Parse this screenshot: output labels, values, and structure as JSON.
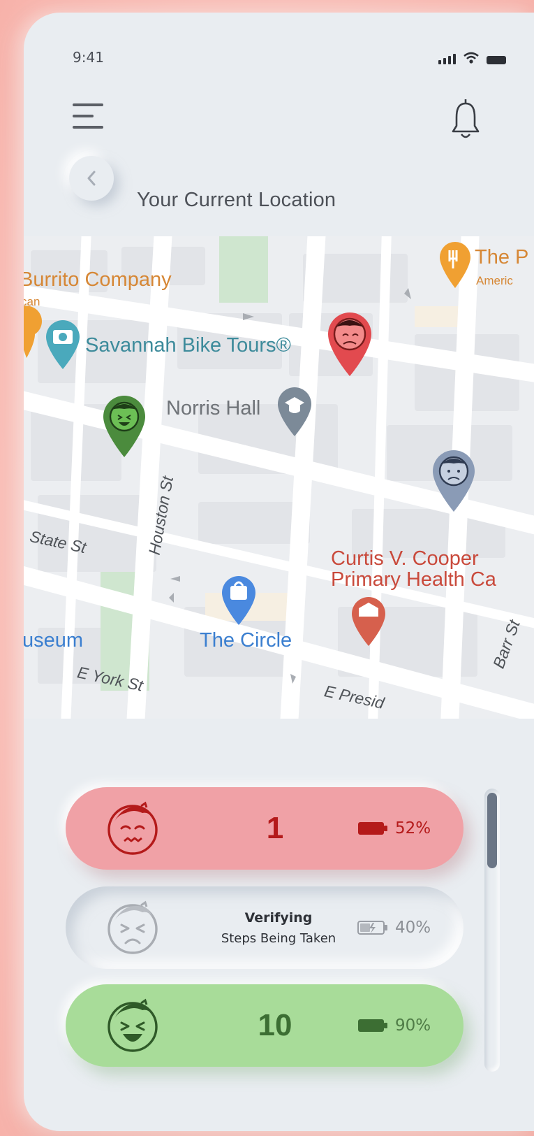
{
  "status_bar": {
    "time": "9:41"
  },
  "header": {
    "title": "Your Current Location"
  },
  "map": {
    "pois": [
      {
        "name": "The Burrito Company",
        "label": "Burrito Company",
        "sub": "can"
      },
      {
        "name": "The Pirate's House",
        "label": "The P",
        "sub": "Americ"
      },
      {
        "label": "Savannah Bike Tours®"
      },
      {
        "label": "Norris Hall"
      },
      {
        "label": "Curtis V. Cooper",
        "label2": "Primary Health Ca"
      },
      {
        "label": "The Circle"
      },
      {
        "label": "useum"
      }
    ],
    "streets": [
      "State St",
      "Houston St",
      "E York St",
      "E Presid",
      "Barr St"
    ]
  },
  "cards": [
    {
      "mood": "sad",
      "count": "1",
      "battery": "52%"
    },
    {
      "mood": "verifying",
      "title": "Verifying",
      "subtitle": "Steps Being Taken",
      "battery": "40%"
    },
    {
      "mood": "happy",
      "count": "10",
      "battery": "90%"
    }
  ],
  "colors": {
    "background": "#fbc4bd",
    "surface": "#e9edf1",
    "card_red": "#f0a1a6",
    "card_green": "#a8dc99",
    "pin_red": "#e24a4f",
    "pin_green": "#4b8b3d",
    "pin_blue": "#8a9bb6"
  },
  "icons": [
    "menu-icon",
    "bell-icon",
    "chevron-left-icon",
    "battery-icon",
    "map-pin-icon"
  ]
}
